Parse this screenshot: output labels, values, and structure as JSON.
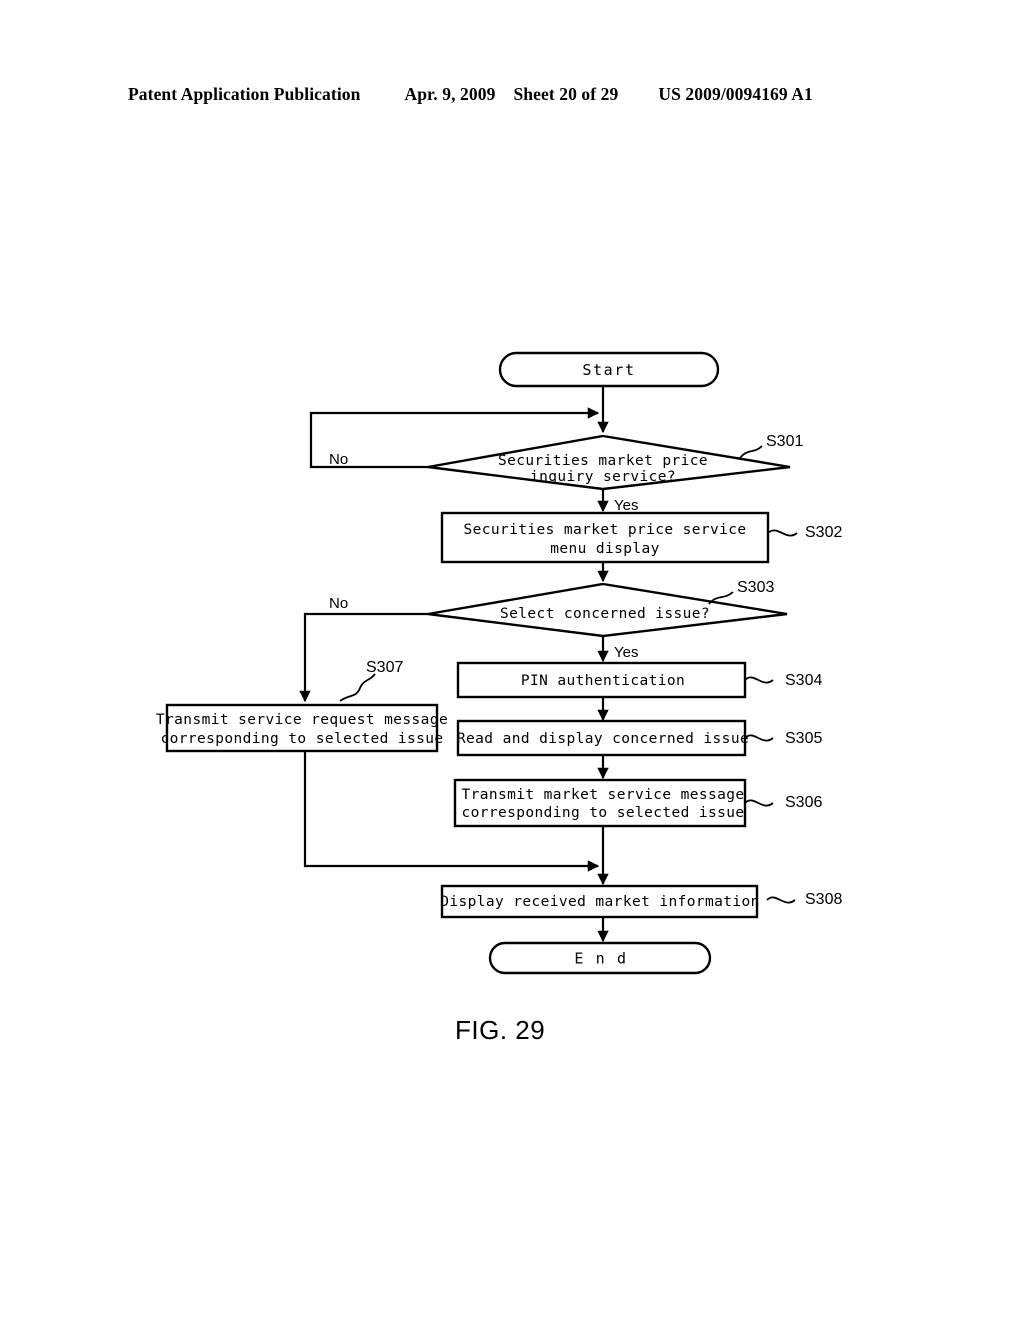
{
  "header": {
    "publication": "Patent Application Publication",
    "date": "Apr. 9, 2009",
    "sheet": "Sheet 20 of 29",
    "patent_number": "US 2009/0094169 A1"
  },
  "figure": {
    "caption": "FIG. 29",
    "terminators": {
      "start": "Start",
      "end": "E n d"
    },
    "branch_labels": {
      "s301_no": "No",
      "s301_yes": "Yes",
      "s303_no": "No",
      "s303_yes": "Yes"
    },
    "nodes": [
      {
        "id": "S301",
        "ref": "S301",
        "type": "decision",
        "line1": "Securities market price",
        "line2": "inquiry service?"
      },
      {
        "id": "S302",
        "ref": "S302",
        "type": "process",
        "line1": "Securities market price service",
        "line2": "menu display"
      },
      {
        "id": "S303",
        "ref": "S303",
        "type": "decision",
        "line1": "Select concerned issue?",
        "line2": ""
      },
      {
        "id": "S304",
        "ref": "S304",
        "type": "process",
        "line1": "PIN authentication",
        "line2": ""
      },
      {
        "id": "S305",
        "ref": "S305",
        "type": "process",
        "line1": "Read and display concerned issue",
        "line2": ""
      },
      {
        "id": "S306",
        "ref": "S306",
        "type": "process",
        "line1": "Transmit market service message",
        "line2": "corresponding to selected issue"
      },
      {
        "id": "S307",
        "ref": "S307",
        "type": "process",
        "line1": "Transmit service request message",
        "line2": "corresponding to selected issue"
      },
      {
        "id": "S308",
        "ref": "S308",
        "type": "process",
        "line1": "Display received market information",
        "line2": ""
      }
    ]
  },
  "colors": {
    "ink": "#000000",
    "paper": "#ffffff"
  }
}
